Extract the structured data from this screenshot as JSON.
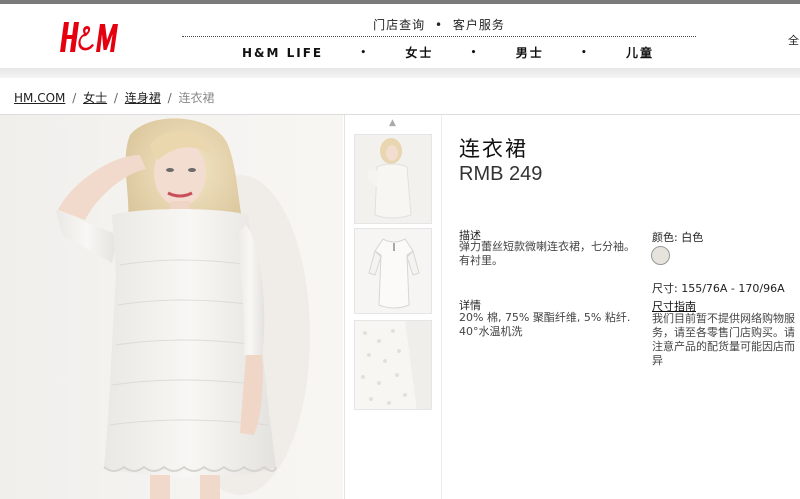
{
  "header": {
    "brand_logo": "H&M",
    "utility_links": [
      "门店查询",
      "客户服务"
    ],
    "utility_separator": "•",
    "nav": [
      "H&M LIFE",
      "女士",
      "男士",
      "儿童"
    ],
    "nav_separator": "•",
    "edge_text": "全",
    "brand_color": "#e50010"
  },
  "breadcrumb": {
    "items": [
      "HM.COM",
      "女士",
      "连身裙"
    ],
    "current": "连衣裙",
    "separator": "/"
  },
  "gallery": {
    "up_arrow_icon": "chevron-up-icon",
    "thumbnail_count": 3
  },
  "product": {
    "title": "连衣裙",
    "price": "RMB 249",
    "description_label": "描述",
    "description_text": "弹力蕾丝短款微喇连衣裙，七分袖。有衬里。",
    "details_label": "详情",
    "details_text": "20% 棉, 75% 聚酯纤维, 5% 粘纤. 40°水温机洗",
    "color_label": "颜色: 白色",
    "color_swatch": "#e6e3dd",
    "size_label": "尺寸: 155/76A - 170/96A",
    "size_guide_link": "尺寸指南",
    "availability_text": "我们目前暂不提供网络购物服务，请至各零售门店购买。请注意产品的配货量可能因店而异"
  }
}
